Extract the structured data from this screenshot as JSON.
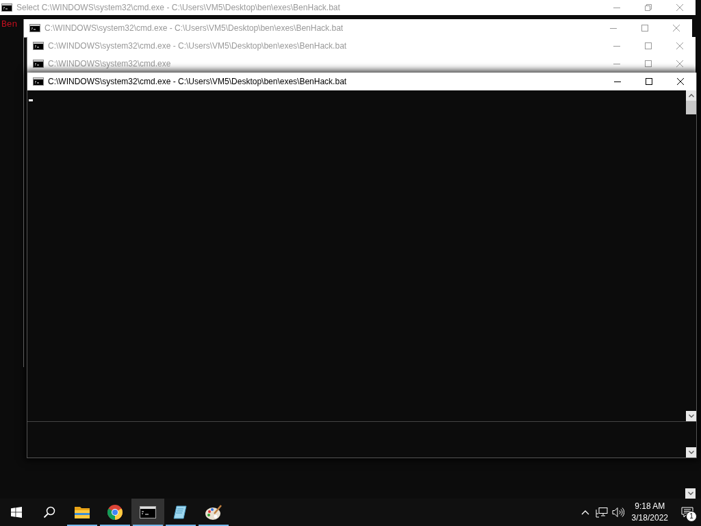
{
  "windows": [
    {
      "title": "Select C:\\WINDOWS\\system32\\cmd.exe - C:\\Users\\VM5\\Desktop\\ben\\exes\\BenHack.bat",
      "active": false,
      "maximized": true,
      "lines": [
        {
          "text": "Ben",
          "color": "#c50f1f"
        }
      ]
    },
    {
      "title": "C:\\WINDOWS\\system32\\cmd.exe - C:\\Users\\VM5\\Desktop\\ben\\exes\\BenHack.bat",
      "active": false,
      "maximized": false
    },
    {
      "title": "C:\\WINDOWS\\system32\\cmd.exe - C:\\Users\\VM5\\Desktop\\ben\\exes\\BenHack.bat",
      "active": false,
      "maximized": false
    },
    {
      "title": "C:\\WINDOWS\\system32\\cmd.exe",
      "active": false,
      "maximized": false
    },
    {
      "title": "C:\\WINDOWS\\system32\\cmd.exe - C:\\Users\\VM5\\Desktop\\ben\\exes\\BenHack.bat",
      "active": true,
      "maximized": false
    }
  ],
  "taskbar_apps": [
    {
      "kind": "folder",
      "running": true,
      "selected": false
    },
    {
      "kind": "browser",
      "running": true,
      "selected": false
    },
    {
      "kind": "terminal",
      "running": true,
      "selected": true
    },
    {
      "kind": "notepad",
      "running": true,
      "selected": false
    },
    {
      "kind": "paint",
      "running": true,
      "selected": false
    }
  ],
  "tray": {
    "time": "9:18 AM",
    "date": "3/18/2022",
    "notifications": "1"
  }
}
